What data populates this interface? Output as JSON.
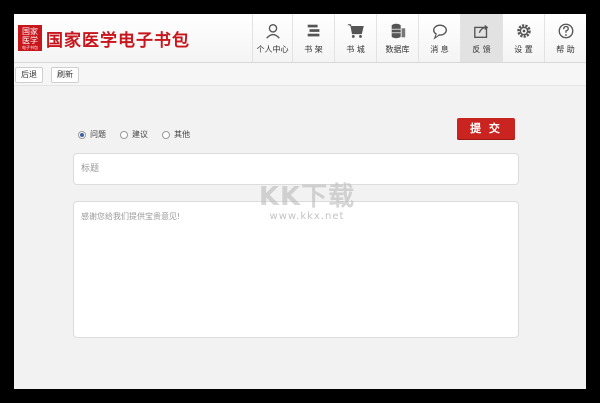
{
  "app": {
    "logo_seal_line1": "国家",
    "logo_seal_line2": "医学",
    "logo_seal_line3": "电子书包",
    "logo_title": "国家医学电子书包"
  },
  "nav": {
    "items": [
      {
        "label": "个人中心",
        "icon": "user-icon"
      },
      {
        "label": "书 架",
        "icon": "bookshelf-icon"
      },
      {
        "label": "书 城",
        "icon": "cart-icon"
      },
      {
        "label": "数据库",
        "icon": "database-icon"
      },
      {
        "label": "消 息",
        "icon": "message-icon"
      },
      {
        "label": "反 馈",
        "icon": "share-icon",
        "active": true
      },
      {
        "label": "设 置",
        "icon": "gear-icon"
      },
      {
        "label": "帮 助",
        "icon": "help-icon"
      }
    ]
  },
  "toolbar": {
    "back_label": "后退",
    "refresh_label": "刷新"
  },
  "feedback": {
    "types": [
      {
        "label": "问题",
        "checked": true
      },
      {
        "label": "建议",
        "checked": false
      },
      {
        "label": "其他",
        "checked": false
      }
    ],
    "submit_label": "提 交",
    "title_placeholder": "标题",
    "content_placeholder": "感谢您给我们提供宝贵意见!"
  },
  "watermark": {
    "big": "KK下载",
    "small": "www.kkx.net"
  },
  "colors": {
    "brand_red": "#c8161d",
    "submit_red": "#c9241f"
  }
}
